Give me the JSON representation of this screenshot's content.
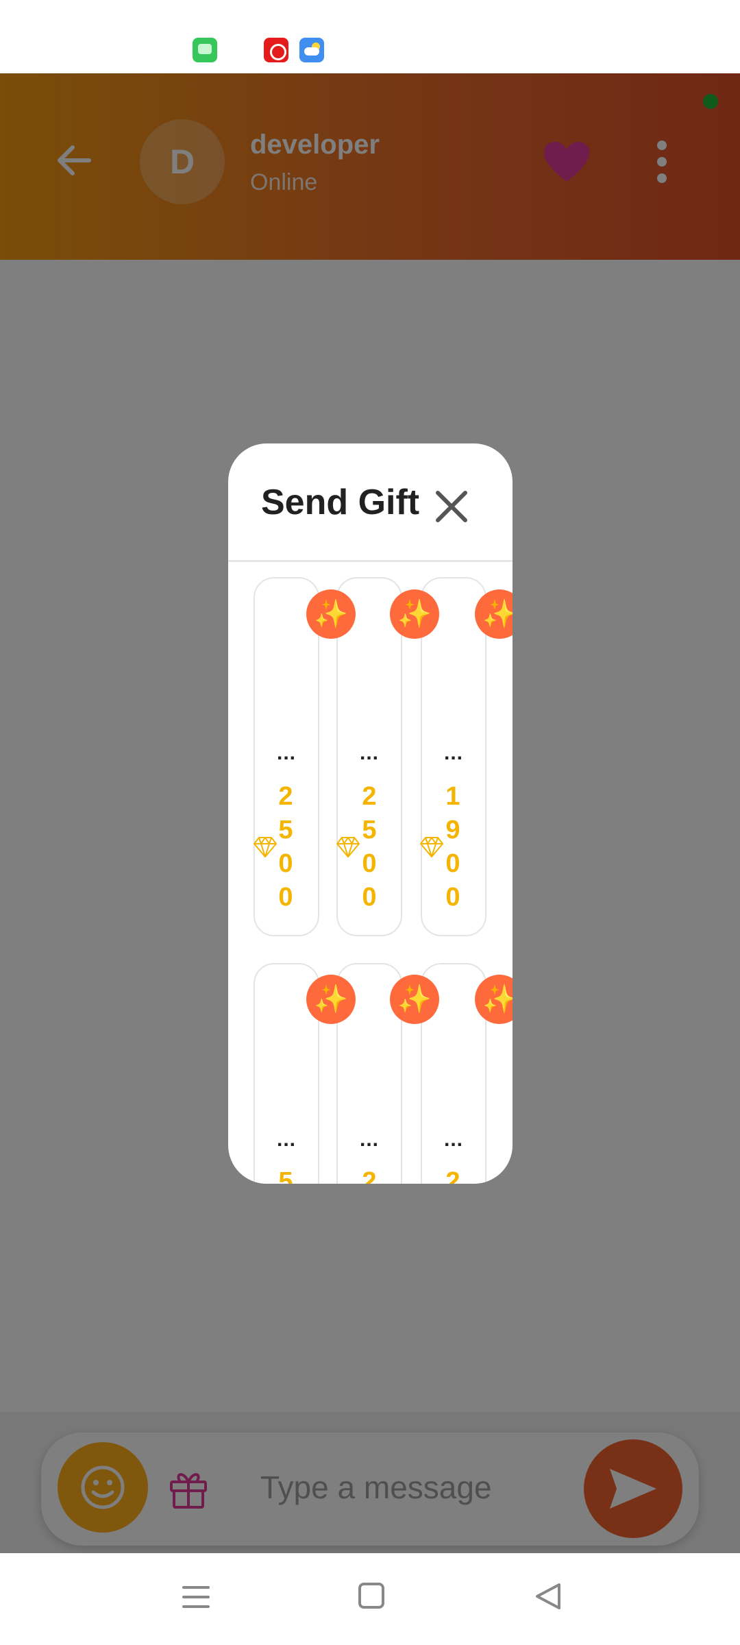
{
  "header": {
    "avatar_initial": "D",
    "contact_name": "developer",
    "contact_status": "Online"
  },
  "input": {
    "placeholder": "Type a message"
  },
  "dialog": {
    "title": "Send Gift",
    "gifts": [
      {
        "name": "...",
        "price": "2500",
        "icon": "sparkles"
      },
      {
        "name": "...",
        "price": "2500",
        "icon": "sparkles"
      },
      {
        "name": "...",
        "price": "1900",
        "icon": "sparkles"
      },
      {
        "name": "...",
        "price": "5",
        "icon": "sparkles"
      },
      {
        "name": "...",
        "price": "2",
        "icon": "sparkles"
      },
      {
        "name": "...",
        "price": "2",
        "icon": "sparkles"
      }
    ]
  },
  "colors": {
    "header_gradient_start": "#f39c12",
    "header_gradient_end": "#e0502b",
    "accent_orange": "#f0622f",
    "price_gold": "#f5b400",
    "heart": "#e0389a"
  },
  "icons": [
    "back-arrow-icon",
    "heart-icon",
    "more-vert-icon",
    "emoji-icon",
    "gift-icon",
    "send-icon",
    "close-icon",
    "sparkles-icon",
    "gem-icon"
  ]
}
